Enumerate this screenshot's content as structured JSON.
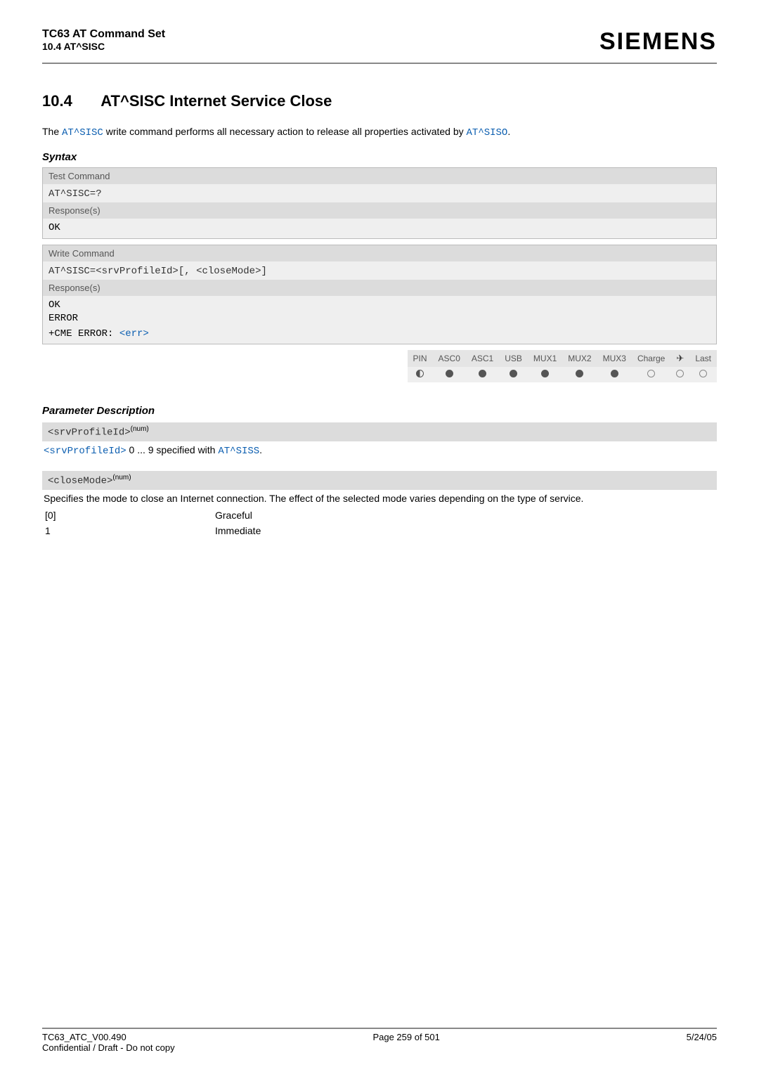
{
  "header": {
    "title": "TC63 AT Command Set",
    "subtitle": "10.4 AT^SISC",
    "brand": "SIEMENS"
  },
  "section": {
    "number": "10.4",
    "title": "AT^SISC   Internet Service Close"
  },
  "intro": {
    "prefix": "The ",
    "cmd1": "AT^SISC",
    "mid": " write command performs all necessary action to release all properties activated by ",
    "cmd2": "AT^SISO",
    "suffix": "."
  },
  "syntax": {
    "label": "Syntax",
    "test_cmd_label": "Test Command",
    "test_cmd": "AT^SISC=?",
    "resp_label": "Response(s)",
    "ok": "OK",
    "write_cmd_label": "Write Command",
    "write_cmd_prefix": "AT^SISC=",
    "write_param1": "<srvProfileId>",
    "write_sep": "[, ",
    "write_param2": "<closeMode>",
    "write_end": "]",
    "error": "ERROR",
    "cme_prefix": "+CME ERROR: ",
    "cme_err": "<err>"
  },
  "status": {
    "headers": [
      "PIN",
      "ASC0",
      "ASC1",
      "USB",
      "MUX1",
      "MUX2",
      "MUX3",
      "Charge",
      "✈",
      "Last"
    ],
    "values": [
      "half",
      "full",
      "full",
      "full",
      "full",
      "full",
      "full",
      "empty",
      "empty",
      "empty"
    ]
  },
  "params": {
    "heading": "Parameter Description",
    "p1_name": "<srvProfileId>",
    "num_sup": "(num)",
    "p1_desc_link": "<srvProfileId>",
    "p1_desc_mid": " 0 ... 9 specified with ",
    "p1_desc_cmd": "AT^SISS",
    "p1_desc_end": ".",
    "p2_name": "<closeMode>",
    "p2_desc": "Specifies the mode to close an Internet connection. The effect of the selected mode varies depending on the type of service.",
    "p2_rows": [
      {
        "val": "[0]",
        "label": "Graceful"
      },
      {
        "val": "1",
        "label": "Immediate"
      }
    ]
  },
  "footer": {
    "left1": "TC63_ATC_V00.490",
    "left2": "Confidential / Draft - Do not copy",
    "center": "Page 259 of 501",
    "right": "5/24/05"
  }
}
